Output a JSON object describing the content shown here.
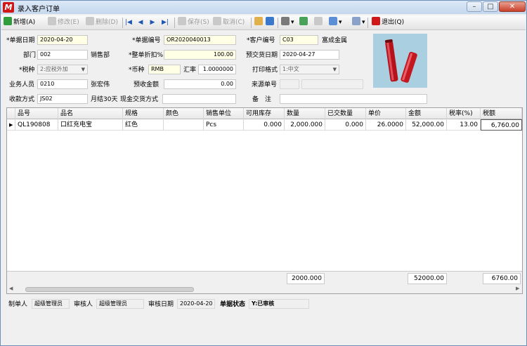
{
  "window": {
    "title": "录入客户订单"
  },
  "toolbar": {
    "add": "新增(A)",
    "edit": "修改(E)",
    "delete": "删除(D)",
    "save": "保存(S)",
    "cancel": "取消(C)",
    "exit": "退出(Q)"
  },
  "form": {
    "date_label": "*单据日期",
    "date_value": "2020-04-20",
    "doc_no_label": "*单据编号",
    "doc_no_value": "OR2020040013",
    "customer_label": "*客户编号",
    "customer_value": "C03",
    "customer_name": "富成金属",
    "dept_label": "部门",
    "dept_value": "002",
    "dept_name": "销售部",
    "discount_label": "*整单折扣%",
    "discount_value": "100.00",
    "expected_label": "预交货日期",
    "expected_value": "2020-04-27",
    "tax_label": "*税种",
    "tax_value": "2:应税外加",
    "currency_label": "*币种",
    "currency_value": "RMB",
    "rate_label": "汇率",
    "rate_value": "1.0000000",
    "print_label": "打印格式",
    "print_value": "1:中文",
    "sales_label": "业务人员",
    "sales_value": "0210",
    "sales_name": "张宏伟",
    "prepay_label": "预收金额",
    "prepay_value": "0.00",
    "source_label": "来源单号",
    "source_value": "",
    "pay_label": "收款方式",
    "pay_value": "JS02",
    "pay_name": "月结30天",
    "delivery_label": "现金交货方式",
    "delivery_value": "",
    "remark_label": "备　注",
    "remark_value": ""
  },
  "grid": {
    "headers": [
      "品号",
      "品名",
      "规格",
      "颜色",
      "销售单位",
      "可用库存",
      "数量",
      "已交数量",
      "单价",
      "金额",
      "税率(%)",
      "税额"
    ],
    "rows": [
      [
        "QL190808",
        "口红充电宝",
        "红色",
        "",
        "Pcs",
        "0.000",
        "2,000.000",
        "0.000",
        "26.0000",
        "52,000.00",
        "13.00",
        "6,760.00"
      ]
    ],
    "totals": {
      "qty": "2000.000",
      "amount": "52000.00",
      "tax": "6760.00"
    }
  },
  "status": {
    "maker_label": "制单人",
    "maker_value": "超级管理员",
    "auditor_label": "审核人",
    "auditor_value": "超级管理员",
    "audit_date_label": "审核日期",
    "audit_date_value": "2020-04-20",
    "state_label": "单据状态",
    "state_value": "Y:已审核"
  },
  "colors": {
    "required_bg": "#ffffe6",
    "field_border": "#c9c9c9",
    "product_bg": "#a9cfe0",
    "accent_red": "#d01818"
  },
  "icons": {
    "app": "app-logo-icon",
    "add": "add-icon",
    "edit": "edit-icon",
    "delete": "delete-icon",
    "first": "first-icon",
    "prev": "prev-icon",
    "next": "next-icon",
    "last": "last-icon",
    "save": "save-icon",
    "cancel": "cancel-icon",
    "exit": "exit-icon"
  }
}
